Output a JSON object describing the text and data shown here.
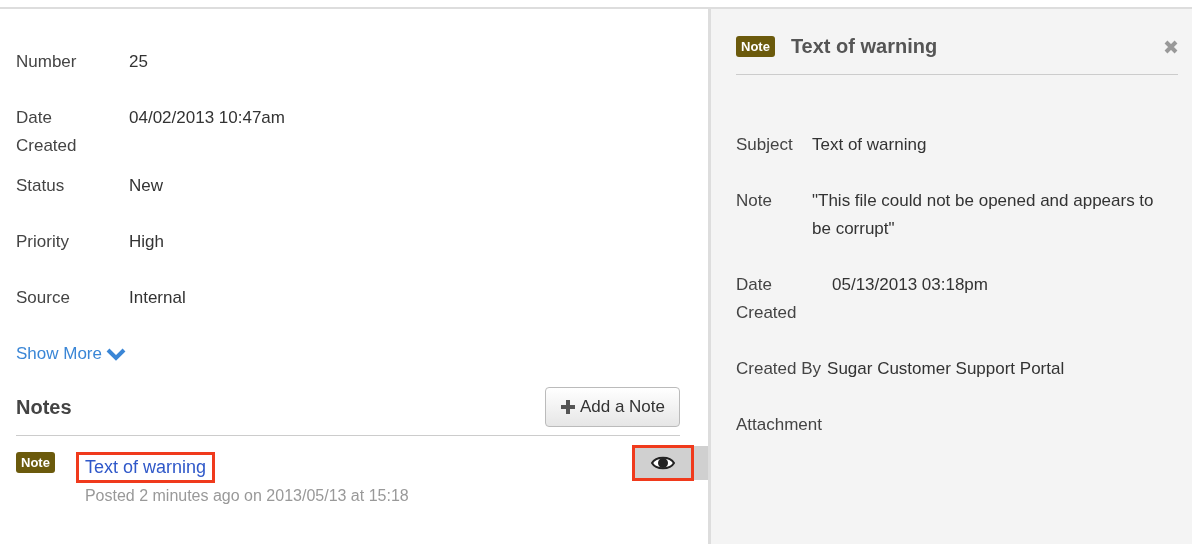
{
  "details": [
    {
      "label": "Number",
      "value": "25"
    },
    {
      "label": "Date Created",
      "value": "04/02/2013 10:47am"
    },
    {
      "label": "Status",
      "value": "New"
    },
    {
      "label": "Priority",
      "value": "High"
    },
    {
      "label": "Source",
      "value": "Internal"
    }
  ],
  "show_more": "Show More",
  "notes": {
    "title": "Notes",
    "add_button": "Add a Note",
    "items": [
      {
        "badge": "Note",
        "title": "Text of warning",
        "meta": "Posted 2 minutes ago on 2013/05/13 at 15:18",
        "selected": true,
        "highlighted": true
      }
    ]
  },
  "preview": {
    "badge": "Note",
    "title": "Text of warning",
    "fields": [
      {
        "label": "Subject",
        "value": "Text of warning"
      },
      {
        "label": "Note",
        "value": "\"This file could not be opened and appears to be corrupt\""
      },
      {
        "label": "Date Created",
        "value": "05/13/2013 03:18pm"
      },
      {
        "label": "Created By",
        "value": "Sugar Customer Support Portal"
      },
      {
        "label": "Attachment"
      }
    ]
  }
}
